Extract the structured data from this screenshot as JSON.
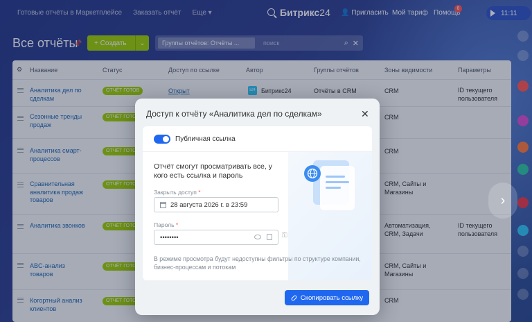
{
  "topbar": {
    "nav": [
      "Готовые отчёты в Маркетплейсе",
      "Заказать отчёт",
      "Еще ▾"
    ],
    "brand": "Битрикс",
    "brand_num": "24",
    "invite": "Пригласить",
    "tariff": "Мой тариф",
    "help": "Помощь",
    "help_badge": "6",
    "time": "11:11"
  },
  "page": {
    "title": "Все отчёты",
    "create_label": "Создать",
    "filter_tag": "Группы отчётов: Отчёты ...",
    "search_placeholder": "поиск"
  },
  "table": {
    "headers": [
      "Название",
      "Статус",
      "Доступ по ссылке",
      "Автор",
      "Группы отчётов",
      "Зоны видимости",
      "Параметры"
    ],
    "rows": [
      {
        "name": "Аналитика дел по сделкам",
        "status": "ОТЧЁТ ГОТОВ",
        "access": "Открыт",
        "author": "Битрикс24",
        "author_badge": "b24",
        "group": "Отчёты в CRM",
        "zones": "CRM",
        "params": "ID текущего пользователя"
      },
      {
        "name": "Сезонные тренды продаж",
        "status": "ОТЧЁТ ГОТОВ",
        "zones": "CRM"
      },
      {
        "name": "Аналитика смарт-процессов",
        "status": "ОТЧЁТ ГОТОВ",
        "zones": "CRM"
      },
      {
        "name": "Сравнительная аналитика продаж товаров",
        "status": "ОТЧЁТ ГОТОВ",
        "zones": "CRM, Сайты и Магазины"
      },
      {
        "name": "Аналитика звонков",
        "status": "ОТЧЁТ ГОТОВ",
        "zones": "Автоматизация, CRM, Задачи",
        "params": "ID текущего пользователя"
      },
      {
        "name": "ABC-анализ товаров",
        "status": "ОТЧЁТ ГОТОВ",
        "zones": "CRM, Сайты и Магазины"
      },
      {
        "name": "Когортный анализ клиентов",
        "status": "ОТЧЁТ ГОТОВ",
        "zones": "CRM"
      }
    ]
  },
  "modal": {
    "title": "Доступ к отчёту «Аналитика дел по сделкам»",
    "toggle_label": "Публичная ссылка",
    "description": "Отчёт смогут просматривать все, у кого есть ссылка и пароль",
    "close_label": "Закрыть доступ",
    "close_value": "28 августа 2026 г. в 23:59",
    "password_label": "Пароль",
    "password_value": "••••••••",
    "note": "В режиме просмотра будут недоступны фильтры по структуре компании, бизнес-процессам и потокам",
    "copy_button": "Скопировать ссылку"
  },
  "colors": {
    "accent": "#2067f0",
    "create_green": "#9dcf00",
    "link_blue": "#2067b0"
  }
}
